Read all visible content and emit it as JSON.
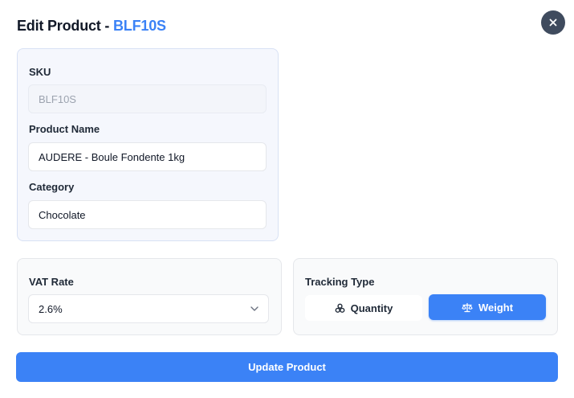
{
  "header": {
    "title_prefix": "Edit Product - ",
    "product_sku": "BLF10S",
    "close_icon": "close-icon"
  },
  "form": {
    "sku": {
      "label": "SKU",
      "value": "BLF10S"
    },
    "product_name": {
      "label": "Product Name",
      "value": "AUDERE - Boule Fondente 1kg"
    },
    "category": {
      "label": "Category",
      "value": "Chocolate"
    },
    "vat_rate": {
      "label": "VAT Rate",
      "value": "2.6%"
    },
    "tracking_type": {
      "label": "Tracking Type",
      "options": [
        {
          "label": "Quantity",
          "icon": "boxes-icon",
          "selected": false
        },
        {
          "label": "Weight",
          "icon": "scale-icon",
          "selected": true
        }
      ]
    }
  },
  "actions": {
    "submit_label": "Update Product"
  },
  "colors": {
    "accent": "#3b82f6",
    "close_bg": "#3f4b5e"
  }
}
